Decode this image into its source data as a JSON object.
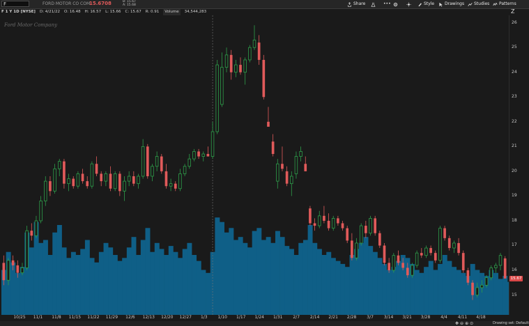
{
  "toolbar": {
    "symbol": "F",
    "company": "FORD MOTOR CO COM",
    "last_price": "15.6708",
    "bid": "B: 15.67",
    "ask": "A: 15.68",
    "buttons": {
      "share": "Share",
      "style": "Style",
      "drawings": "Drawings",
      "studies": "Studies",
      "patterns": "Patterns"
    }
  },
  "infobar": {
    "symbol_desc": "F 1 Y 1D [NYSE]",
    "date": "D: 4/21/22",
    "open": "O: 16.48",
    "high": "H: 16.57",
    "low": "L: 15.66",
    "close": "C: 15.67",
    "range": "R: 0.91",
    "volume_label": "Volume",
    "volume_value": "34,544,283"
  },
  "watermark": "Ford Motor Company",
  "price_flag": "15.67",
  "bottom": {
    "drawing_set": "Drawing set: Default"
  },
  "icons": [
    "share-icon",
    "flask-icon",
    "gear-icon",
    "sun-icon",
    "style-icon",
    "cursor-icon",
    "studies-icon",
    "patterns-icon",
    "zoom-out-icon",
    "zoom-in-icon",
    "pan-icon",
    "z-icon"
  ],
  "colors": {
    "up": "#2e9e4a",
    "down": "#e05a5a",
    "volume": "#0f5f87",
    "background": "#1a1a1a"
  },
  "chart_data": {
    "type": "candlestick",
    "price_axis": {
      "min": 14.2,
      "max": 26.3,
      "ticks": [
        15,
        16,
        17,
        18,
        19,
        20,
        21,
        22,
        23,
        24,
        25,
        26
      ]
    },
    "date_ticks": [
      "10/25",
      "11/1",
      "11/8",
      "11/15",
      "11/22",
      "11/29",
      "12/6",
      "12/13",
      "12/20",
      "12/27",
      "1/3",
      "1/10",
      "1/17",
      "1/24",
      "1/31",
      "2/7",
      "2/14",
      "2/21",
      "2/28",
      "3/7",
      "3/14",
      "3/21",
      "3/28",
      "4/4",
      "4/11",
      "4/18"
    ],
    "last": 15.67,
    "candles": [
      {
        "o": 16.3,
        "h": 16.6,
        "l": 15.4,
        "c": 15.6
      },
      {
        "o": 15.6,
        "h": 16.5,
        "l": 15.4,
        "c": 16.4
      },
      {
        "o": 16.4,
        "h": 16.6,
        "l": 16.0,
        "c": 16.2
      },
      {
        "o": 16.2,
        "h": 16.4,
        "l": 15.7,
        "c": 15.9
      },
      {
        "o": 15.9,
        "h": 16.3,
        "l": 15.8,
        "c": 16.1
      },
      {
        "o": 16.1,
        "h": 17.8,
        "l": 16.0,
        "c": 17.6
      },
      {
        "o": 17.6,
        "h": 17.9,
        "l": 17.2,
        "c": 17.4
      },
      {
        "o": 17.4,
        "h": 18.2,
        "l": 17.3,
        "c": 18.0
      },
      {
        "o": 18.0,
        "h": 19.0,
        "l": 17.9,
        "c": 18.8
      },
      {
        "o": 18.8,
        "h": 19.8,
        "l": 18.6,
        "c": 19.6
      },
      {
        "o": 19.6,
        "h": 19.8,
        "l": 19.0,
        "c": 19.2
      },
      {
        "o": 19.2,
        "h": 20.3,
        "l": 19.1,
        "c": 20.1
      },
      {
        "o": 20.1,
        "h": 20.5,
        "l": 19.8,
        "c": 20.4
      },
      {
        "o": 20.4,
        "h": 20.5,
        "l": 19.3,
        "c": 19.5
      },
      {
        "o": 19.5,
        "h": 19.9,
        "l": 19.2,
        "c": 19.7
      },
      {
        "o": 19.7,
        "h": 19.8,
        "l": 19.3,
        "c": 19.4
      },
      {
        "o": 19.4,
        "h": 20.0,
        "l": 19.3,
        "c": 19.9
      },
      {
        "o": 19.9,
        "h": 20.1,
        "l": 19.5,
        "c": 19.6
      },
      {
        "o": 19.6,
        "h": 19.8,
        "l": 19.3,
        "c": 19.4
      },
      {
        "o": 19.4,
        "h": 20.4,
        "l": 19.3,
        "c": 20.3
      },
      {
        "o": 20.3,
        "h": 20.6,
        "l": 19.8,
        "c": 19.9
      },
      {
        "o": 19.9,
        "h": 20.0,
        "l": 19.4,
        "c": 19.6
      },
      {
        "o": 19.6,
        "h": 20.0,
        "l": 19.4,
        "c": 19.9
      },
      {
        "o": 19.9,
        "h": 20.2,
        "l": 19.2,
        "c": 19.3
      },
      {
        "o": 19.3,
        "h": 20.0,
        "l": 19.2,
        "c": 19.9
      },
      {
        "o": 19.9,
        "h": 20.0,
        "l": 19.0,
        "c": 19.2
      },
      {
        "o": 19.2,
        "h": 19.8,
        "l": 18.8,
        "c": 19.6
      },
      {
        "o": 19.6,
        "h": 20.0,
        "l": 19.4,
        "c": 19.8
      },
      {
        "o": 19.8,
        "h": 20.0,
        "l": 19.4,
        "c": 19.5
      },
      {
        "o": 19.5,
        "h": 19.9,
        "l": 19.3,
        "c": 19.8
      },
      {
        "o": 19.8,
        "h": 21.3,
        "l": 19.7,
        "c": 21.0
      },
      {
        "o": 21.0,
        "h": 21.1,
        "l": 19.7,
        "c": 19.8
      },
      {
        "o": 19.8,
        "h": 20.3,
        "l": 19.6,
        "c": 20.2
      },
      {
        "o": 20.2,
        "h": 20.8,
        "l": 20.0,
        "c": 20.6
      },
      {
        "o": 20.6,
        "h": 20.7,
        "l": 19.9,
        "c": 20.0
      },
      {
        "o": 20.0,
        "h": 20.3,
        "l": 19.3,
        "c": 19.4
      },
      {
        "o": 19.4,
        "h": 19.7,
        "l": 19.2,
        "c": 19.5
      },
      {
        "o": 19.5,
        "h": 19.6,
        "l": 19.2,
        "c": 19.3
      },
      {
        "o": 19.3,
        "h": 20.1,
        "l": 19.2,
        "c": 19.9
      },
      {
        "o": 19.9,
        "h": 20.3,
        "l": 19.8,
        "c": 20.2
      },
      {
        "o": 20.2,
        "h": 20.7,
        "l": 20.1,
        "c": 20.5
      },
      {
        "o": 20.5,
        "h": 20.9,
        "l": 20.4,
        "c": 20.8
      },
      {
        "o": 20.8,
        "h": 20.9,
        "l": 20.5,
        "c": 20.6
      },
      {
        "o": 20.6,
        "h": 20.8,
        "l": 20.4,
        "c": 20.7
      },
      {
        "o": 20.7,
        "h": 21.0,
        "l": 20.6,
        "c": 20.6
      },
      {
        "o": 20.6,
        "h": 22.0,
        "l": 20.5,
        "c": 21.6
      },
      {
        "o": 21.6,
        "h": 24.5,
        "l": 21.5,
        "c": 24.3
      },
      {
        "o": 22.7,
        "h": 24.8,
        "l": 22.6,
        "c": 24.2
      },
      {
        "o": 24.2,
        "h": 25.0,
        "l": 24.0,
        "c": 24.7
      },
      {
        "o": 24.7,
        "h": 24.9,
        "l": 23.7,
        "c": 24.0
      },
      {
        "o": 24.0,
        "h": 24.5,
        "l": 23.8,
        "c": 24.3
      },
      {
        "o": 24.3,
        "h": 24.6,
        "l": 23.9,
        "c": 24.0
      },
      {
        "o": 24.0,
        "h": 24.6,
        "l": 23.5,
        "c": 24.5
      },
      {
        "o": 24.5,
        "h": 25.1,
        "l": 24.4,
        "c": 25.0
      },
      {
        "o": 25.0,
        "h": 25.9,
        "l": 24.9,
        "c": 25.3
      },
      {
        "o": 25.2,
        "h": 25.5,
        "l": 24.3,
        "c": 24.5
      },
      {
        "o": 24.5,
        "h": 24.7,
        "l": 22.9,
        "c": 23.0
      },
      {
        "o": 22.0,
        "h": 22.6,
        "l": 21.8,
        "c": 21.8
      },
      {
        "o": 21.2,
        "h": 21.5,
        "l": 20.6,
        "c": 20.7
      },
      {
        "o": 19.6,
        "h": 20.5,
        "l": 19.3,
        "c": 20.3
      },
      {
        "o": 20.3,
        "h": 21.0,
        "l": 20.0,
        "c": 20.1
      },
      {
        "o": 20.0,
        "h": 20.2,
        "l": 19.4,
        "c": 19.5
      },
      {
        "o": 19.5,
        "h": 20.0,
        "l": 19.0,
        "c": 19.8
      },
      {
        "o": 19.9,
        "h": 20.8,
        "l": 19.7,
        "c": 20.6
      },
      {
        "o": 20.6,
        "h": 21.0,
        "l": 20.4,
        "c": 20.8
      },
      {
        "o": 20.3,
        "h": 20.6,
        "l": 20.0,
        "c": 20.0
      },
      {
        "o": 18.5,
        "h": 18.6,
        "l": 17.8,
        "c": 17.9
      },
      {
        "o": 17.9,
        "h": 18.1,
        "l": 17.6,
        "c": 17.8
      },
      {
        "o": 17.8,
        "h": 18.4,
        "l": 17.7,
        "c": 18.2
      },
      {
        "o": 18.2,
        "h": 18.6,
        "l": 17.9,
        "c": 18.0
      },
      {
        "o": 18.0,
        "h": 18.3,
        "l": 17.6,
        "c": 17.7
      },
      {
        "o": 17.7,
        "h": 18.2,
        "l": 17.6,
        "c": 18.1
      },
      {
        "o": 18.1,
        "h": 18.2,
        "l": 17.8,
        "c": 17.9
      },
      {
        "o": 17.9,
        "h": 18.0,
        "l": 17.6,
        "c": 17.7
      },
      {
        "o": 17.7,
        "h": 17.8,
        "l": 17.1,
        "c": 17.2
      },
      {
        "o": 17.2,
        "h": 17.5,
        "l": 16.4,
        "c": 16.5
      },
      {
        "o": 16.5,
        "h": 17.3,
        "l": 16.4,
        "c": 17.1
      },
      {
        "o": 17.1,
        "h": 17.9,
        "l": 17.0,
        "c": 17.8
      },
      {
        "o": 17.8,
        "h": 18.0,
        "l": 17.3,
        "c": 17.5
      },
      {
        "o": 17.5,
        "h": 18.2,
        "l": 17.4,
        "c": 18.1
      },
      {
        "o": 18.1,
        "h": 18.2,
        "l": 17.4,
        "c": 17.5
      },
      {
        "o": 17.5,
        "h": 17.6,
        "l": 16.9,
        "c": 17.0
      },
      {
        "o": 17.0,
        "h": 17.1,
        "l": 16.2,
        "c": 16.3
      },
      {
        "o": 16.3,
        "h": 16.5,
        "l": 15.9,
        "c": 16.0
      },
      {
        "o": 16.0,
        "h": 16.7,
        "l": 15.9,
        "c": 16.6
      },
      {
        "o": 16.6,
        "h": 16.8,
        "l": 16.2,
        "c": 16.3
      },
      {
        "o": 16.3,
        "h": 16.5,
        "l": 16.0,
        "c": 16.1
      },
      {
        "o": 16.1,
        "h": 16.3,
        "l": 15.7,
        "c": 15.8
      },
      {
        "o": 15.8,
        "h": 16.3,
        "l": 15.7,
        "c": 16.2
      },
      {
        "o": 16.2,
        "h": 16.8,
        "l": 16.1,
        "c": 16.7
      },
      {
        "o": 16.7,
        "h": 16.9,
        "l": 16.5,
        "c": 16.6
      },
      {
        "o": 16.6,
        "h": 17.0,
        "l": 16.5,
        "c": 16.9
      },
      {
        "o": 16.9,
        "h": 17.0,
        "l": 16.6,
        "c": 16.7
      },
      {
        "o": 16.7,
        "h": 16.8,
        "l": 16.3,
        "c": 16.4
      },
      {
        "o": 16.4,
        "h": 17.8,
        "l": 16.3,
        "c": 17.7
      },
      {
        "o": 17.7,
        "h": 17.8,
        "l": 17.2,
        "c": 17.3
      },
      {
        "o": 17.3,
        "h": 17.4,
        "l": 16.8,
        "c": 16.9
      },
      {
        "o": 16.9,
        "h": 17.2,
        "l": 16.7,
        "c": 17.1
      },
      {
        "o": 17.1,
        "h": 17.3,
        "l": 16.6,
        "c": 16.7
      },
      {
        "o": 16.7,
        "h": 16.8,
        "l": 15.9,
        "c": 16.0
      },
      {
        "o": 16.0,
        "h": 16.1,
        "l": 15.4,
        "c": 15.5
      },
      {
        "o": 15.5,
        "h": 15.6,
        "l": 14.8,
        "c": 15.0
      },
      {
        "o": 15.0,
        "h": 15.5,
        "l": 14.9,
        "c": 15.3
      },
      {
        "o": 15.3,
        "h": 15.6,
        "l": 15.1,
        "c": 15.4
      },
      {
        "o": 15.4,
        "h": 15.8,
        "l": 15.3,
        "c": 15.7
      },
      {
        "o": 15.7,
        "h": 16.2,
        "l": 15.6,
        "c": 16.1
      },
      {
        "o": 16.1,
        "h": 16.3,
        "l": 15.9,
        "c": 16.2
      },
      {
        "o": 16.2,
        "h": 16.7,
        "l": 16.0,
        "c": 16.6
      },
      {
        "o": 16.48,
        "h": 16.57,
        "l": 15.66,
        "c": 15.67
      }
    ],
    "volume_max_m": 100,
    "volume": [
      30,
      42,
      35,
      28,
      32,
      55,
      45,
      62,
      48,
      50,
      40,
      55,
      60,
      45,
      38,
      42,
      40,
      44,
      50,
      38,
      35,
      42,
      48,
      45,
      40,
      36,
      38,
      45,
      52,
      40,
      50,
      58,
      42,
      48,
      44,
      40,
      46,
      42,
      38,
      44,
      48,
      40,
      36,
      30,
      28,
      42,
      65,
      62,
      55,
      58,
      50,
      52,
      48,
      45,
      56,
      58,
      50,
      52,
      48,
      56,
      52,
      46,
      44,
      40,
      48,
      50,
      60,
      48,
      44,
      40,
      42,
      38,
      36,
      34,
      32,
      40,
      44,
      48,
      52,
      46,
      42,
      38,
      34,
      30,
      32,
      36,
      40,
      38,
      34,
      30,
      28,
      32,
      36,
      30,
      34,
      40,
      36,
      32,
      30,
      28,
      26,
      34,
      30,
      28,
      26,
      30,
      28,
      24,
      26,
      22
    ]
  }
}
